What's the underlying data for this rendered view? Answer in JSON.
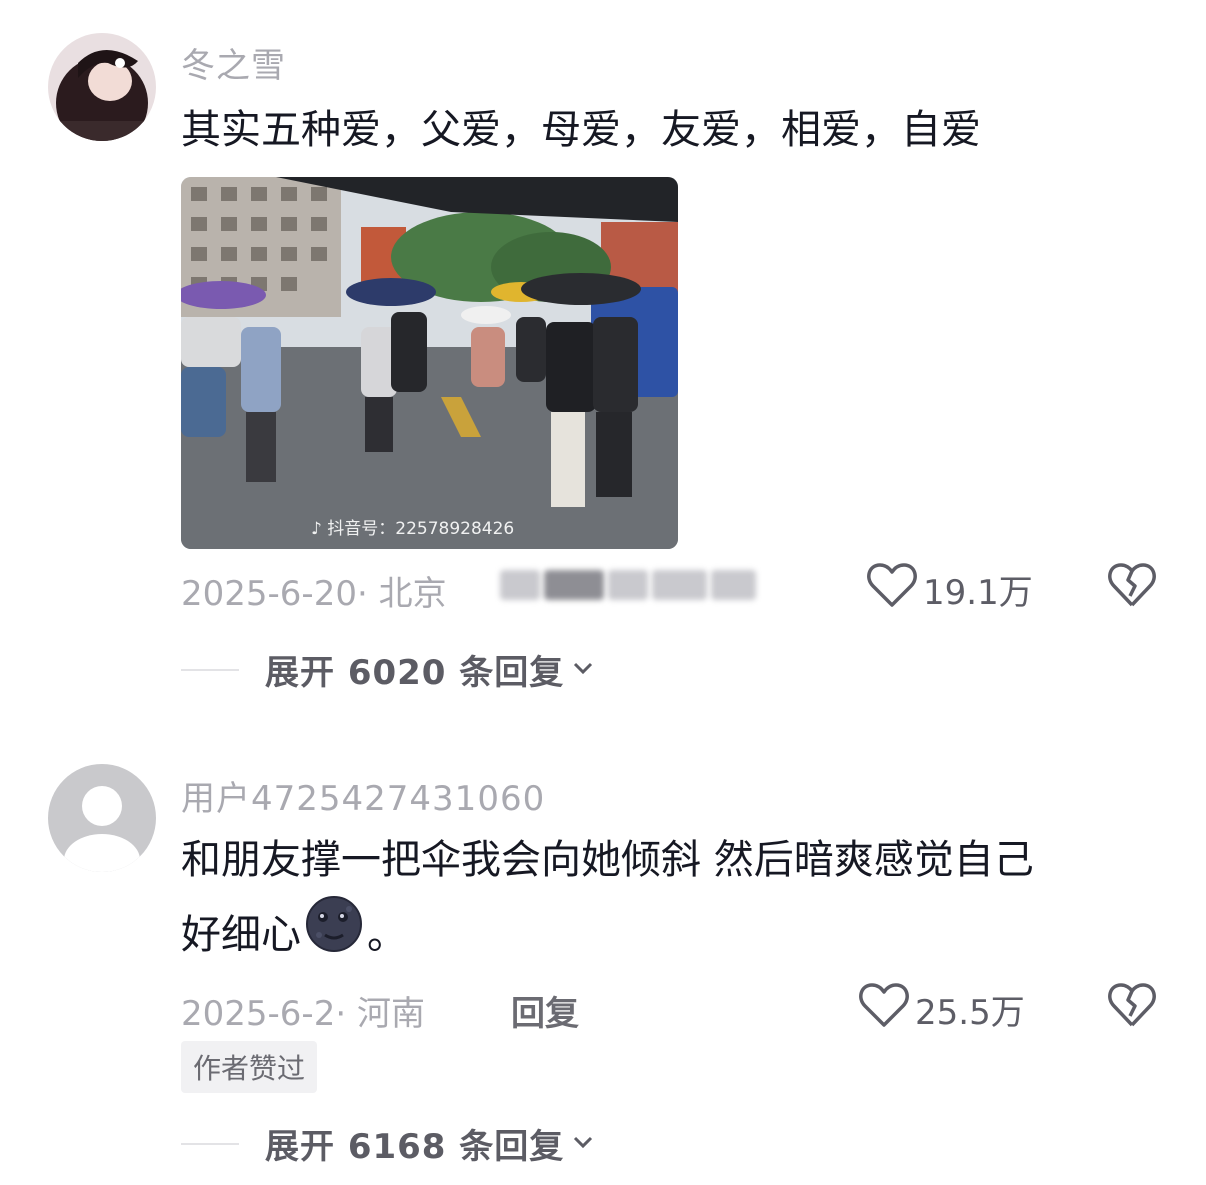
{
  "comments": [
    {
      "username": "冬之雪",
      "text": "其实五种爱，父爱，母爱，友爱，相爱，自爱",
      "image": {
        "watermark": "抖音号：22578928426"
      },
      "meta": "2025-6-20· 北京",
      "likes": "19.1万",
      "expand_label": "展开 6020 条回复"
    },
    {
      "username": "用户4725427431060",
      "text_line1": "和朋友撑一把伞我会向她倾斜 然后暗爽感觉自己",
      "text_line2": "好细心",
      "text_end": "。",
      "meta": "2025-6-2· 河南",
      "reply_label": "回复",
      "likes": "25.5万",
      "badge": "作者赞过",
      "expand_label": "展开 6168 条回复"
    }
  ],
  "icons": {
    "like": "heart-outline-icon",
    "dislike": "broken-heart-icon",
    "expand": "chevron-down-icon",
    "emoji": "new-moon-face-emoji"
  }
}
